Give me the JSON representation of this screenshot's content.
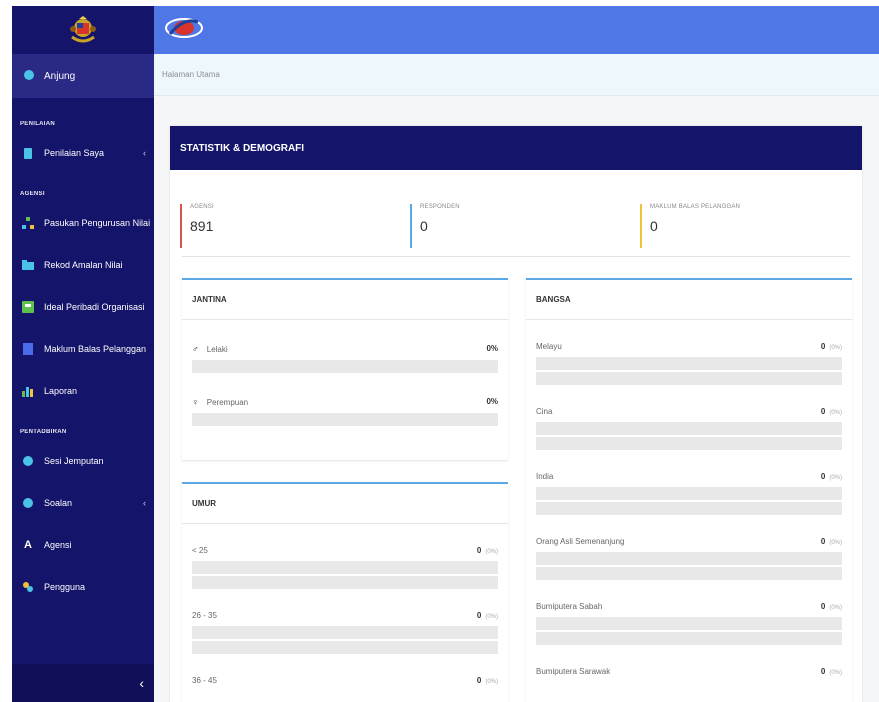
{
  "sidebar": {
    "active_item": "Anjung",
    "sections": {
      "penilaian": "PENILAIAN",
      "agensi": "AGENSI",
      "pentadbiran": "PENTADBIRAN"
    },
    "items": {
      "penilaian_saya": "Penilaian Saya",
      "pasukan": "Pasukan Pengurusan Nilai",
      "rekod": "Rekod Amalan Nilai",
      "ideal": "Ideal Peribadi Organisasi",
      "maklum": "Maklum Balas Pelanggan",
      "laporan": "Laporan",
      "sesi": "Sesi Jemputan",
      "soalan": "Soalan",
      "agensi": "Agensi",
      "pengguna": "Pengguna"
    },
    "collapse": "‹"
  },
  "breadcrumb": "Halaman Utama",
  "panel": {
    "title": "STATISTIK & DEMOGRAFI",
    "stats": [
      {
        "label": "AGENSI",
        "value": "891"
      },
      {
        "label": "RESPONDEN",
        "value": "0"
      },
      {
        "label": "MAKLUM BALAS PELANGGAN",
        "value": "0"
      }
    ]
  },
  "jantina": {
    "title": "JANTINA",
    "rows": [
      {
        "label": "Lelaki",
        "value": "0%"
      },
      {
        "label": "Perempuan",
        "value": "0%"
      }
    ]
  },
  "umur": {
    "title": "UMUR",
    "rows": [
      {
        "label": "< 25",
        "value": "0",
        "pct": "(0%)"
      },
      {
        "label": "26 - 35",
        "value": "0",
        "pct": "(0%)"
      },
      {
        "label": "36 - 45",
        "value": "0",
        "pct": "(0%)"
      }
    ]
  },
  "bangsa": {
    "title": "BANGSA",
    "rows": [
      {
        "label": "Melayu",
        "value": "0",
        "pct": "(0%)"
      },
      {
        "label": "Cina",
        "value": "0",
        "pct": "(0%)"
      },
      {
        "label": "India",
        "value": "0",
        "pct": "(0%)"
      },
      {
        "label": "Orang Asli Semenanjung",
        "value": "0",
        "pct": "(0%)"
      },
      {
        "label": "Bumiputera Sabah",
        "value": "0",
        "pct": "(0%)"
      },
      {
        "label": "Bumiputera Sarawak",
        "value": "0",
        "pct": "(0%)"
      }
    ]
  },
  "colors": {
    "sidebar": "#14146b",
    "topbar": "#4f78e6",
    "stat_agensi": "#d9534f",
    "stat_responden": "#5aa9e6",
    "stat_maklum": "#f0c23b"
  }
}
